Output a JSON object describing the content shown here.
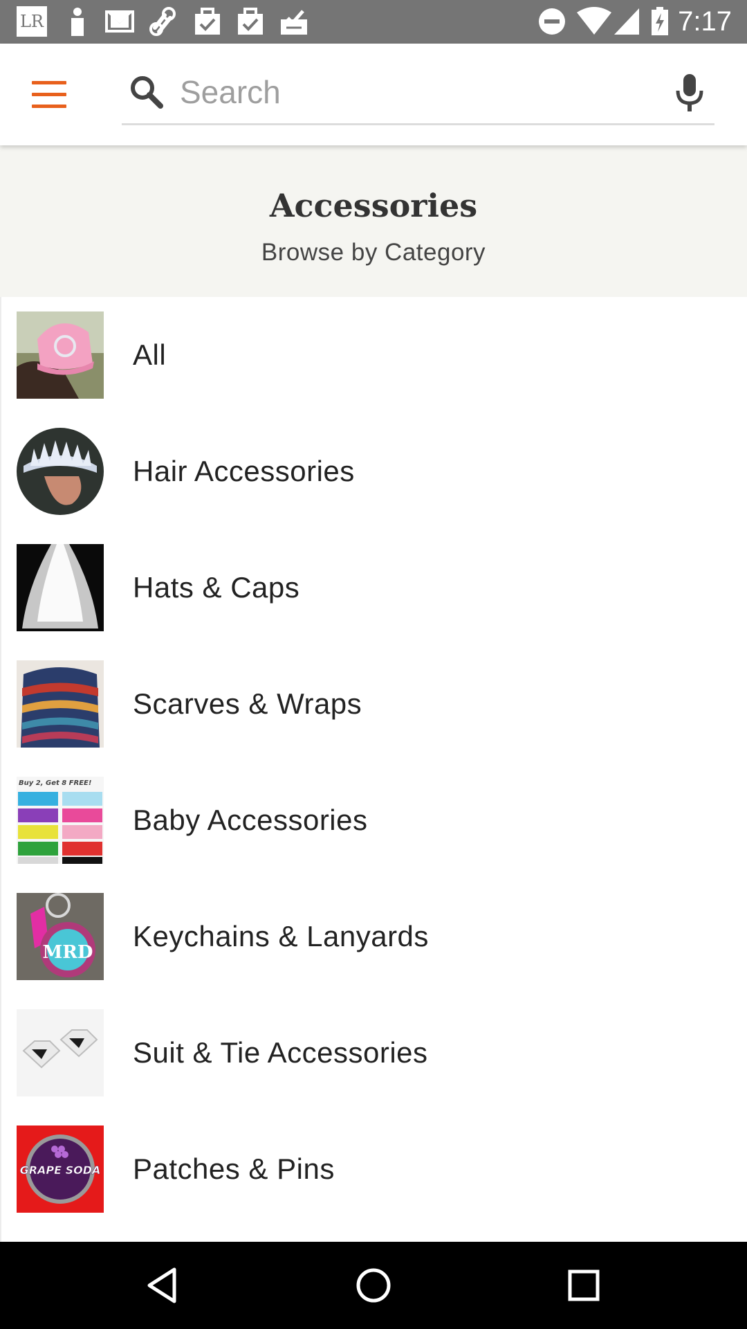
{
  "status_bar": {
    "time": "7:17",
    "left_icons": [
      "lr-app-icon",
      "person-icon",
      "gmail-icon",
      "link-icon",
      "bag-check-icon",
      "bag-check-icon",
      "inbox-check-icon"
    ],
    "right_icons": [
      "dnd-icon",
      "wifi-icon",
      "signal-icon",
      "battery-icon"
    ],
    "lr_text": "LR"
  },
  "search": {
    "placeholder": "Search",
    "value": ""
  },
  "header": {
    "title": "Accessories",
    "subtitle": "Browse by Category"
  },
  "categories": [
    {
      "label": "All",
      "thumb": "pink-cap-image"
    },
    {
      "label": "Hair Accessories",
      "thumb": "crystal-crown-image"
    },
    {
      "label": "Hats & Caps",
      "thumb": "bridal-veil-image"
    },
    {
      "label": "Scarves & Wraps",
      "thumb": "tribal-scarf-image"
    },
    {
      "label": "Baby Accessories",
      "thumb": "baby-headbands-image",
      "thumb_text": "Buy 2, Get 8 FREE!"
    },
    {
      "label": "Keychains & Lanyards",
      "thumb": "monogram-keychain-image",
      "thumb_text": "MRD"
    },
    {
      "label": "Suit & Tie Accessories",
      "thumb": "superman-cufflinks-image"
    },
    {
      "label": "Patches & Pins",
      "thumb": "grape-soda-pin-image",
      "thumb_text": "GRAPE SODA"
    }
  ],
  "colors": {
    "accent": "#e8601c",
    "status_bar": "#757575",
    "header_bg": "#f5f5f1",
    "nav_bar": "#000000"
  }
}
